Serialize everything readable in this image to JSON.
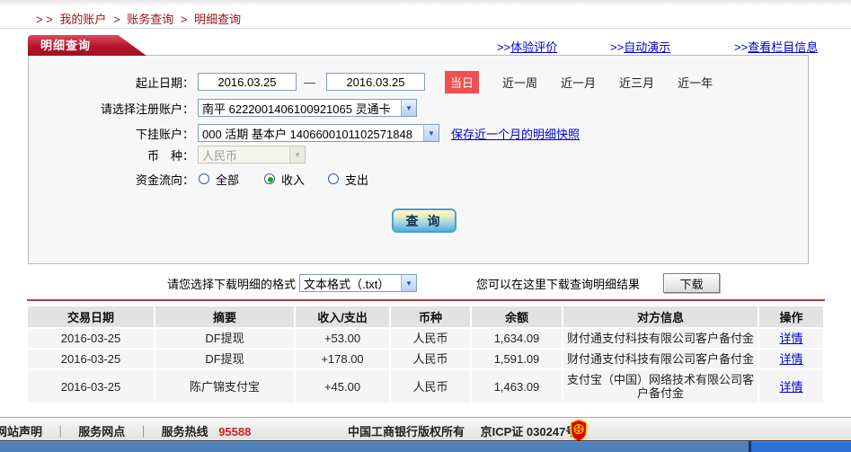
{
  "breadcrumb": {
    "prefix": "> >",
    "separator": ">",
    "items": [
      "我的账户",
      "账务查询",
      "明细查询"
    ]
  },
  "tab_title": "明细查询",
  "top_links": [
    {
      "prefix": ">>",
      "label": "体验评价"
    },
    {
      "prefix": ">>",
      "label": "自动演示"
    },
    {
      "prefix": ">>",
      "label": "查看栏目信息"
    }
  ],
  "form": {
    "date_label": "起止日期：",
    "date_from": "2016.03.25",
    "date_separator": "—",
    "date_to": "2016.03.25",
    "today_button": "当日",
    "quick_ranges": [
      "近一周",
      "近一月",
      "近三月",
      "近一年"
    ],
    "account_label": "请选择注册账户：",
    "account_value": "南平 6222001406100921065 灵通卡",
    "sub_account_label": "下挂账户：",
    "sub_account_value": "000 活期 基本户 1406600101102571848",
    "snapshot_link": "保存近一个月的明细快照",
    "currency_label": "币　种：",
    "currency_value": "人民币",
    "flow_label": "资金流向：",
    "flow_options": [
      {
        "label": "全部",
        "selected": false
      },
      {
        "label": "收入",
        "selected": true
      },
      {
        "label": "支出",
        "selected": false
      }
    ],
    "query_button": "查 询"
  },
  "download": {
    "format_label": "请您选择下载明细的格式",
    "format_value": "文本格式（.txt）",
    "result_label": "您可以在这里下载查询明细结果",
    "button": "下载"
  },
  "table": {
    "headers": [
      "交易日期",
      "摘要",
      "收入/支出",
      "币种",
      "余额",
      "对方信息",
      "操作"
    ],
    "rows": [
      {
        "date": "2016-03-25",
        "summary": "DF提现",
        "amount": "+53.00",
        "currency": "人民币",
        "balance": "1,634.09",
        "counterparty": "财付通支付科技有限公司客户备付金",
        "action": "详情"
      },
      {
        "date": "2016-03-25",
        "summary": "DF提现",
        "amount": "+178.00",
        "currency": "人民币",
        "balance": "1,591.09",
        "counterparty": "财付通支付科技有限公司客户备付金",
        "action": "详情"
      },
      {
        "date": "2016-03-25",
        "summary": "陈广锦支付宝",
        "amount": "+45.00",
        "currency": "人民币",
        "balance": "1,463.09",
        "counterparty": "支付宝（中国）网络技术有限公司客户备付金",
        "action": "详情"
      }
    ]
  },
  "footer": {
    "links": [
      "网站声明",
      "服务网点"
    ],
    "divider": "｜",
    "hotline_label": "服务热线",
    "hotline_number": "95588",
    "copyright": "中国工商银行版权所有",
    "icp": "京ICP证 030247号",
    "badge_icon": "icbc-emblem-icon"
  },
  "colors": {
    "tab_red": "#b5142b",
    "link_blue": "#0000cc",
    "amount_red": "#cc0000",
    "today_bg": "#ee5052",
    "bottom_bar_left": "#4e80bb",
    "bottom_bar_right": "#2b70d4"
  }
}
